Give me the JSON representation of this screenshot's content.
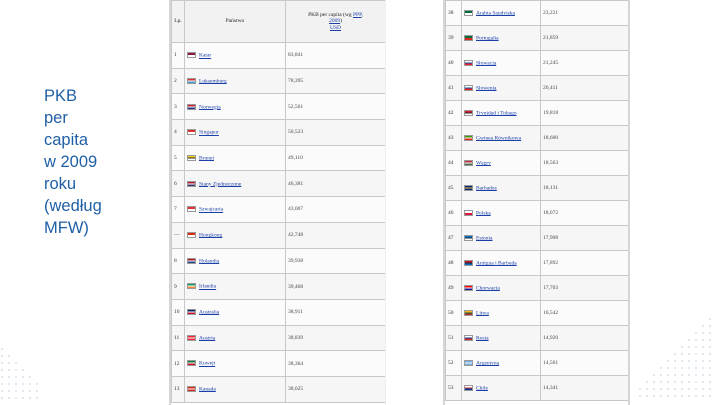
{
  "slide": {
    "title": "PKB\nper\ncapita\nw 2009\nroku\n(według\nMFW)"
  },
  "left_table": {
    "headers": {
      "rank": "Lp.",
      "country": "Państwo",
      "gdp_prefix": "PKB per capita (wg",
      "gdp_link1": "PPP",
      "gdp_link2": "2009",
      "gdp_link3": "USD"
    },
    "rows": [
      {
        "rank": "1",
        "country": "Katar",
        "value": "83,841",
        "flag_colors": [
          "#8b1a3a",
          "#ffffff"
        ]
      },
      {
        "rank": "2",
        "country": "Luksemburg",
        "value": "78,395",
        "flag_colors": [
          "#e03030",
          "#ffffff",
          "#3fa0d8"
        ]
      },
      {
        "rank": "3",
        "country": "Norwegia",
        "value": "52,561",
        "flag_colors": [
          "#c8202f",
          "#ffffff",
          "#1f3a8a"
        ]
      },
      {
        "rank": "4",
        "country": "Singapur",
        "value": "50,523",
        "flag_colors": [
          "#e03030",
          "#ffffff"
        ]
      },
      {
        "rank": "5",
        "country": "Brunei",
        "value": "49,110",
        "flag_colors": [
          "#f4d21c",
          "#222222",
          "#ffffff"
        ]
      },
      {
        "rank": "6",
        "country": "Stany Zjednoczone",
        "value": "46,381",
        "flag_colors": [
          "#b22234",
          "#ffffff",
          "#3c3b6e"
        ]
      },
      {
        "rank": "7",
        "country": "Szwajcaria",
        "value": "43,007",
        "flag_colors": [
          "#e03030",
          "#ffffff"
        ]
      },
      {
        "rank": "—",
        "country": "Hongkong",
        "value": "42,748",
        "flag_colors": [
          "#de2910",
          "#ffffff"
        ]
      },
      {
        "rank": "8",
        "country": "Holandia",
        "value": "39,938",
        "flag_colors": [
          "#ae1c28",
          "#ffffff",
          "#21468b"
        ]
      },
      {
        "rank": "9",
        "country": "Irlandia",
        "value": "39,468",
        "flag_colors": [
          "#169b62",
          "#ffffff",
          "#ff883e"
        ]
      },
      {
        "rank": "10",
        "country": "Australia",
        "value": "38,911",
        "flag_colors": [
          "#012169",
          "#ffffff",
          "#c8102e"
        ]
      },
      {
        "rank": "11",
        "country": "Austria",
        "value": "38,839",
        "flag_colors": [
          "#ed2939",
          "#ffffff",
          "#ed2939"
        ]
      },
      {
        "rank": "12",
        "country": "Kuwejt",
        "value": "38,364",
        "flag_colors": [
          "#007a3d",
          "#ffffff",
          "#ce1126"
        ]
      },
      {
        "rank": "13",
        "country": "Kanada",
        "value": "38,025",
        "flag_colors": [
          "#d52b1e",
          "#ffffff",
          "#d52b1e"
        ]
      }
    ]
  },
  "right_table": {
    "rows": [
      {
        "rank": "38",
        "country": "Arabia Saudyjska",
        "value": "23,221",
        "flag_colors": [
          "#006c35",
          "#ffffff"
        ]
      },
      {
        "rank": "39",
        "country": "Portugalia",
        "value": "21,859",
        "flag_colors": [
          "#046a38",
          "#da291c"
        ]
      },
      {
        "rank": "40",
        "country": "Słowacja",
        "value": "21,245",
        "flag_colors": [
          "#ffffff",
          "#0b4ea2",
          "#ee1c25"
        ]
      },
      {
        "rank": "41",
        "country": "Słowenia",
        "value": "20,411",
        "flag_colors": [
          "#ffffff",
          "#005da4",
          "#ed1c24"
        ]
      },
      {
        "rank": "42",
        "country": "Trynidad i Tobago",
        "value": "19,818",
        "flag_colors": [
          "#da1a35",
          "#222222",
          "#ffffff"
        ]
      },
      {
        "rank": "43",
        "country": "Gwinea Równikowa",
        "value": "18,600",
        "flag_colors": [
          "#3e9a00",
          "#ffffff",
          "#e32118"
        ]
      },
      {
        "rank": "44",
        "country": "Węgry",
        "value": "18,563",
        "flag_colors": [
          "#ce2939",
          "#ffffff",
          "#477050"
        ]
      },
      {
        "rank": "45",
        "country": "Barbados",
        "value": "18,131",
        "flag_colors": [
          "#00267f",
          "#ffc726",
          "#00267f"
        ]
      },
      {
        "rank": "46",
        "country": "Polska",
        "value": "18,072",
        "flag_colors": [
          "#ffffff",
          "#dc143c"
        ]
      },
      {
        "rank": "47",
        "country": "Estonia",
        "value": "17,908",
        "flag_colors": [
          "#0072ce",
          "#222222",
          "#ffffff"
        ]
      },
      {
        "rank": "48",
        "country": "Antigua i Barbuda",
        "value": "17,892",
        "flag_colors": [
          "#ce1126",
          "#222222",
          "#0072c6"
        ]
      },
      {
        "rank": "49",
        "country": "Chorwacja",
        "value": "17,703",
        "flag_colors": [
          "#ff0000",
          "#ffffff",
          "#171796"
        ]
      },
      {
        "rank": "50",
        "country": "Litwa",
        "value": "16,542",
        "flag_colors": [
          "#fdb913",
          "#006a44",
          "#c1272d"
        ]
      },
      {
        "rank": "51",
        "country": "Rosja",
        "value": "14,920",
        "flag_colors": [
          "#ffffff",
          "#0039a6",
          "#d52b1e"
        ]
      },
      {
        "rank": "52",
        "country": "Argentyna",
        "value": "14,561",
        "flag_colors": [
          "#74acdf",
          "#ffffff",
          "#74acdf"
        ]
      },
      {
        "rank": "53",
        "country": "Chile",
        "value": "14,341",
        "flag_colors": [
          "#ffffff",
          "#d52b1e",
          "#0039a6"
        ]
      }
    ]
  }
}
